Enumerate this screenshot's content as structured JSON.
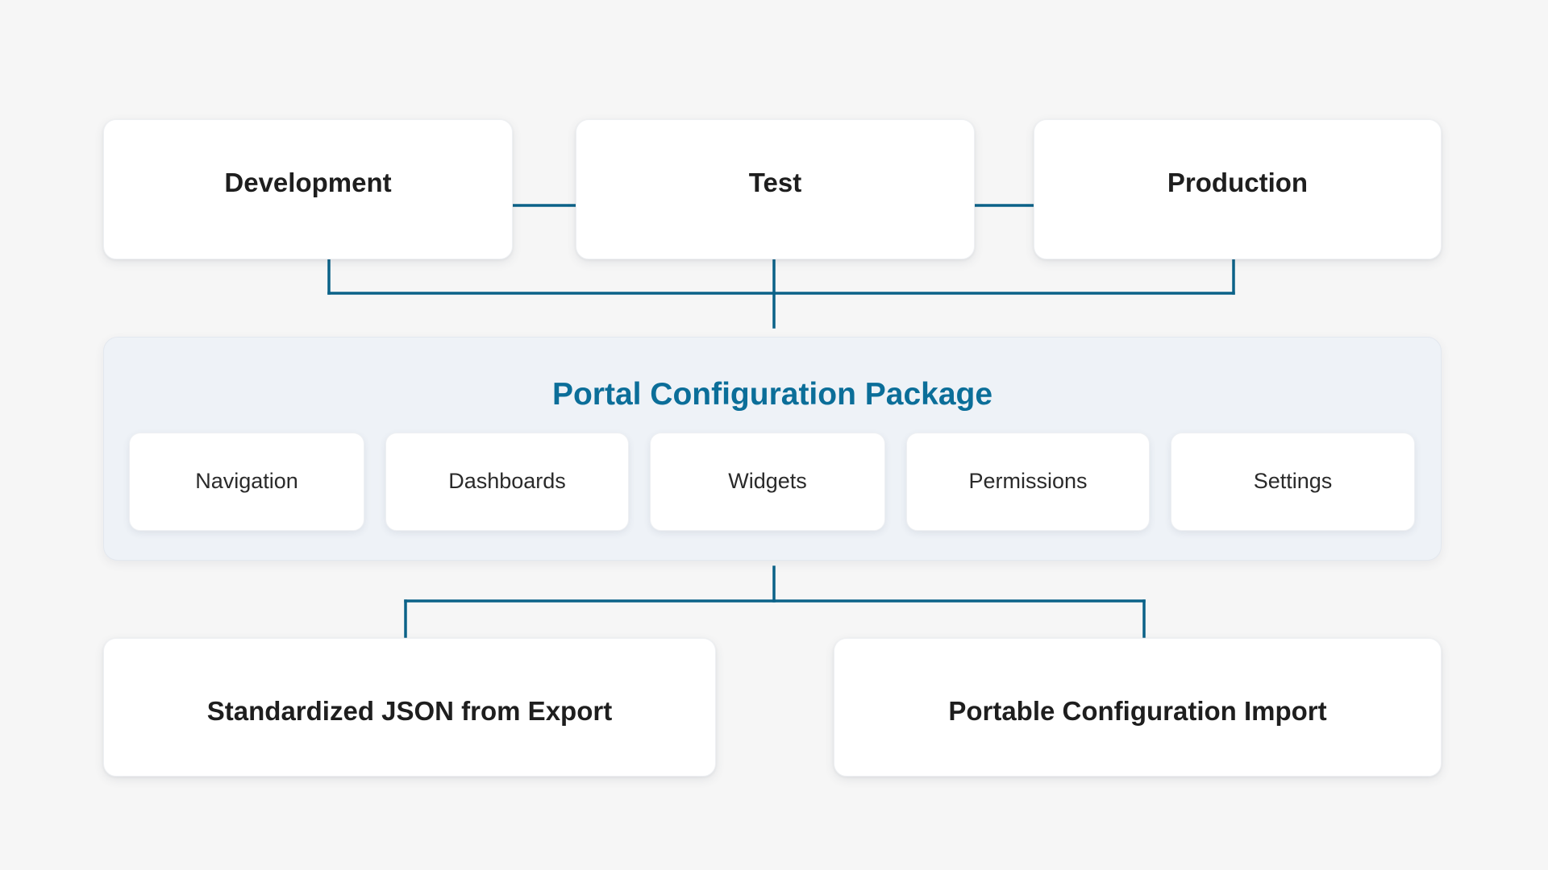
{
  "environments": [
    {
      "label": "Development"
    },
    {
      "label": "Test"
    },
    {
      "label": "Production"
    }
  ],
  "package": {
    "title": "Portal Configuration Package",
    "modules": [
      {
        "label": "Navigation"
      },
      {
        "label": "Dashboards"
      },
      {
        "label": "Widgets"
      },
      {
        "label": "Permissions"
      },
      {
        "label": "Settings"
      }
    ]
  },
  "outputs": [
    {
      "label": "Standardized JSON from Export"
    },
    {
      "label": "Portable Configuration Import"
    }
  ],
  "colors": {
    "background": "#f6f6f6",
    "connector": "#0b6288",
    "accent_title": "#0b6e99",
    "card": "#ffffff",
    "package_panel": "#eef2f7",
    "text": "#1e1e1e"
  }
}
